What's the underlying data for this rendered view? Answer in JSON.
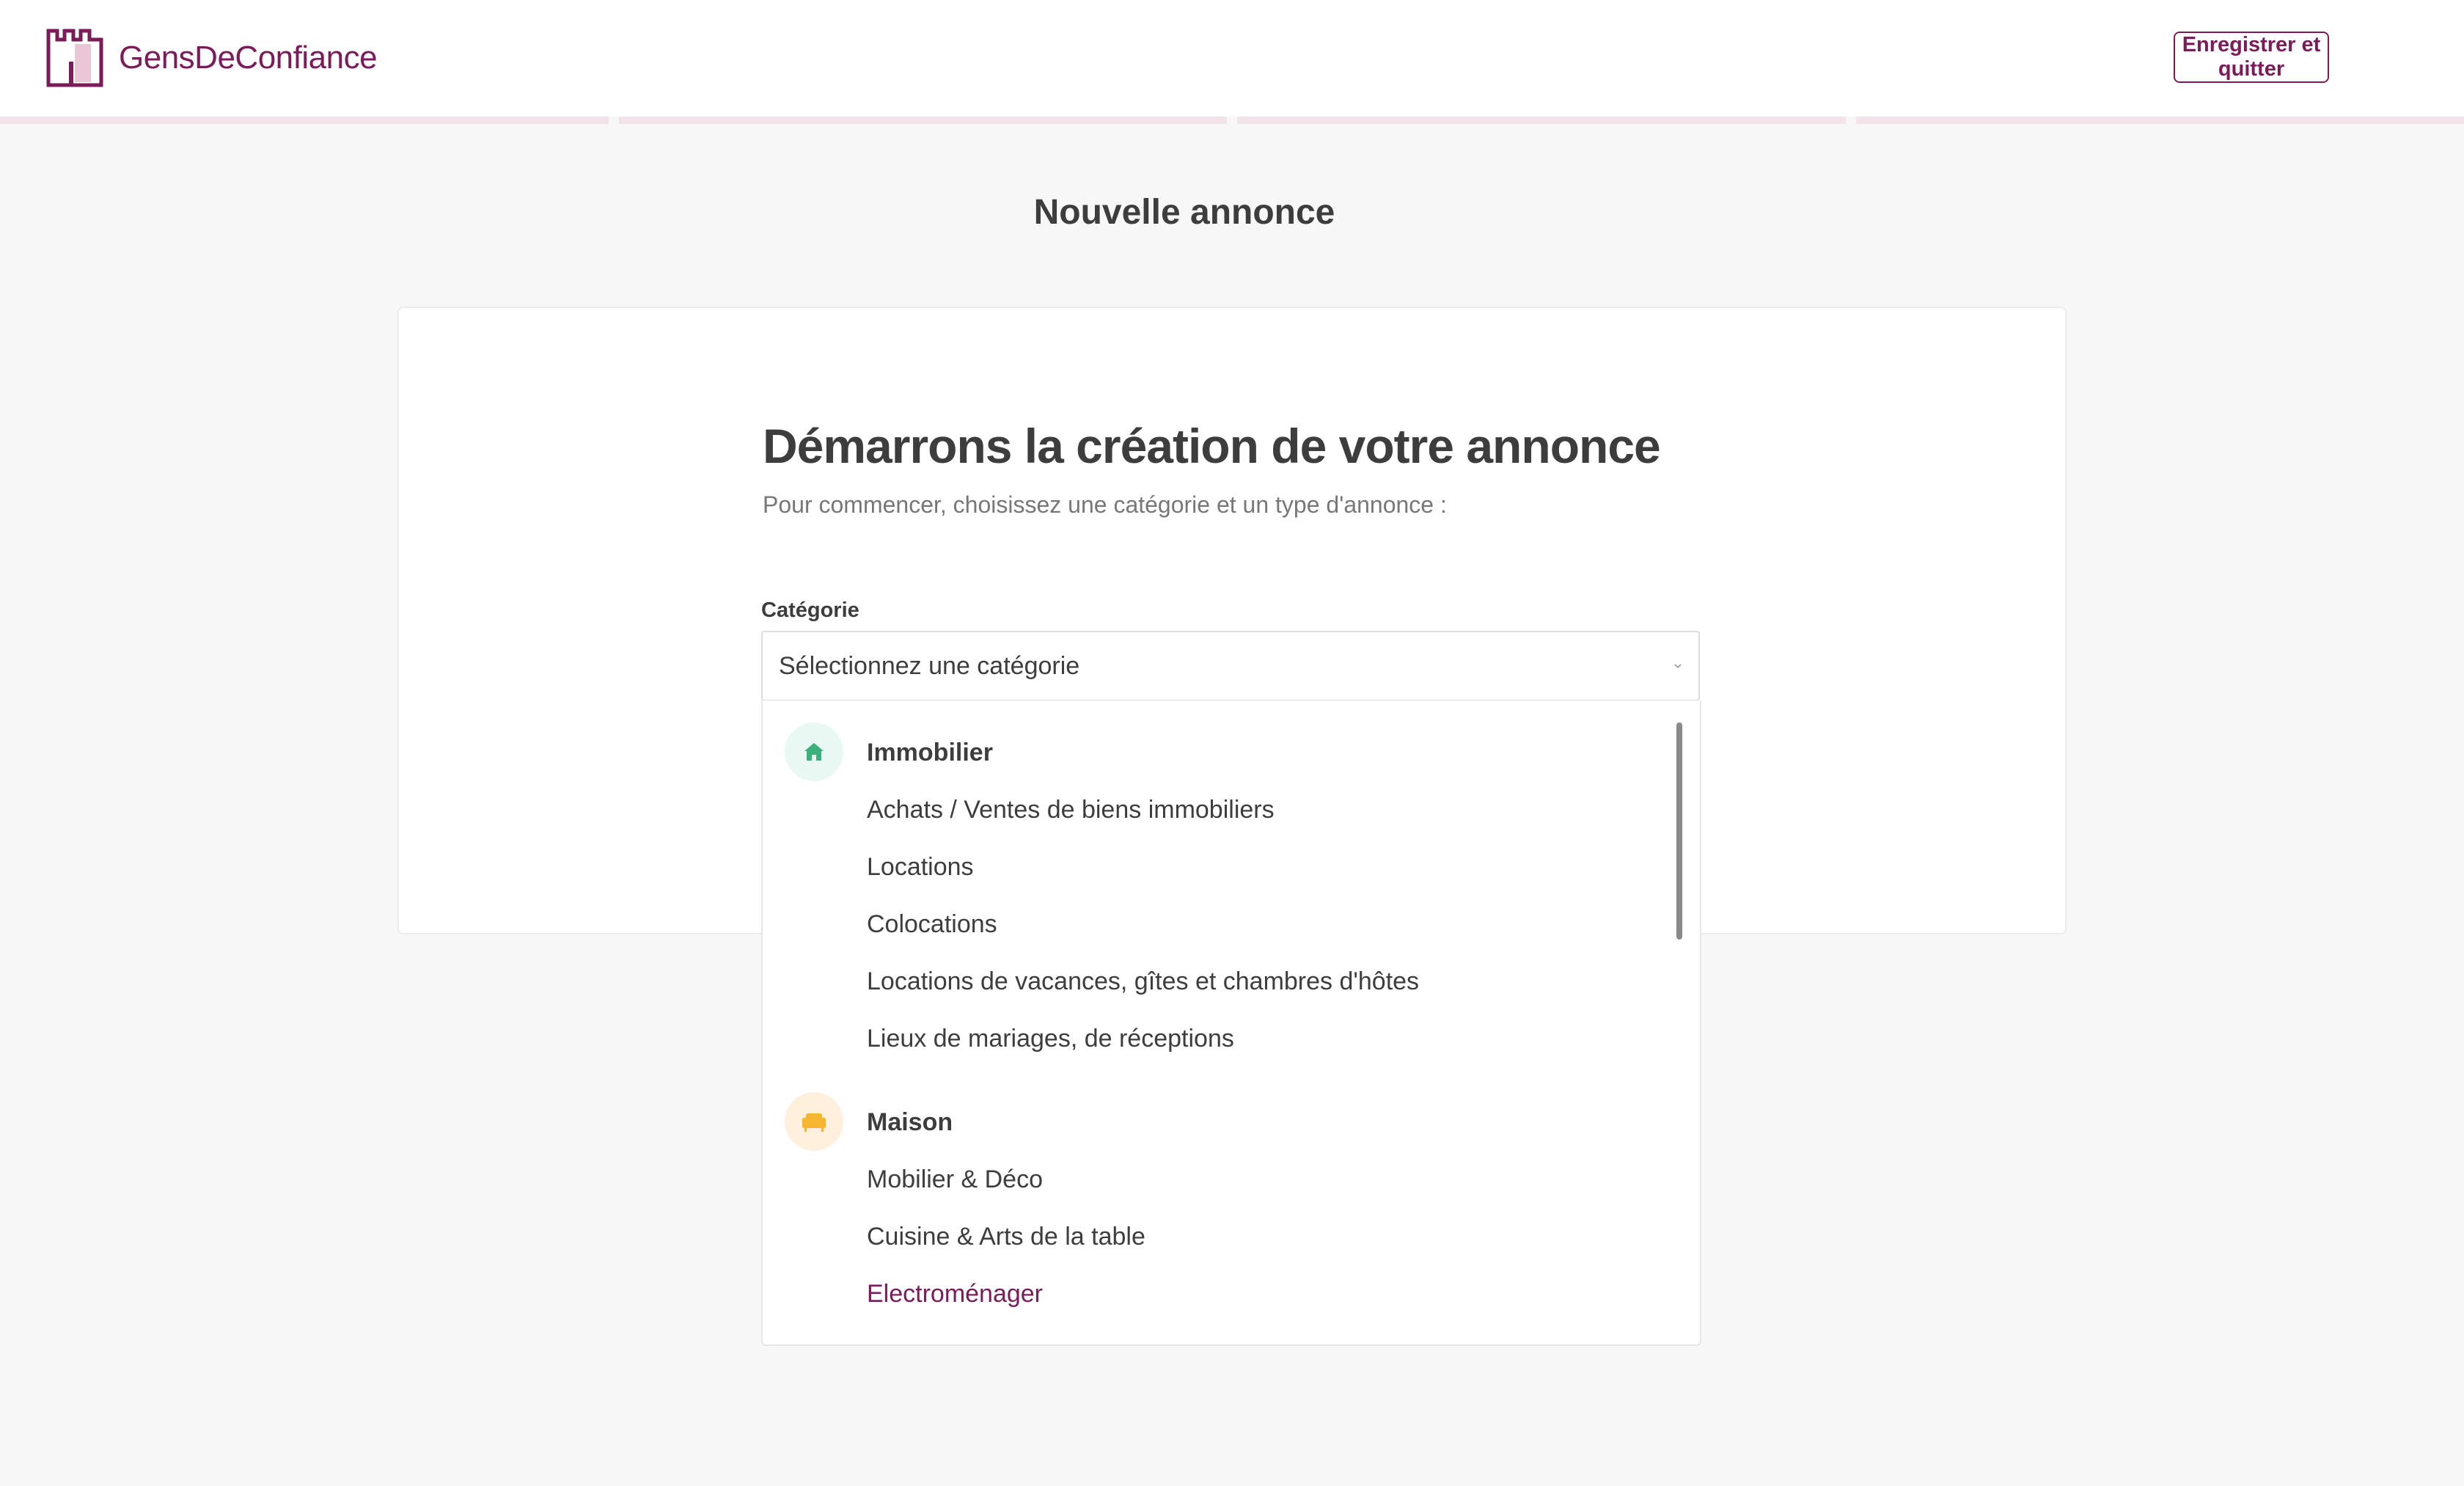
{
  "app": {
    "name": "GensDeConfiance"
  },
  "header": {
    "logo_text": "GensDeConfiance",
    "save_button_label": "Enregistrer et quitter",
    "brand_color": "#7c1b5a"
  },
  "progress": {
    "steps": 4
  },
  "page": {
    "title": "Nouvelle annonce",
    "heading": "Démarrons la création de votre annonce",
    "subheading": "Pour commencer, choisissez une catégorie et un type d'annonce :"
  },
  "category_field": {
    "label": "Catégorie",
    "placeholder": "Sélectionnez une catégorie"
  },
  "dropdown": {
    "groups": [
      {
        "title": "Immobilier",
        "icon": "house-icon",
        "icon_color": "#3bb07a",
        "options": [
          "Achats / Ventes de biens immobiliers",
          "Locations",
          "Colocations",
          "Locations de vacances, gîtes et chambres d'hôtes",
          "Lieux de mariages, de réceptions"
        ]
      },
      {
        "title": "Maison",
        "icon": "armchair-icon",
        "icon_color": "#f5b531",
        "options": [
          "Mobilier & Déco",
          "Cuisine & Arts de la table",
          "Electroménager"
        ],
        "highlighted_option": "Electroménager"
      }
    ]
  }
}
